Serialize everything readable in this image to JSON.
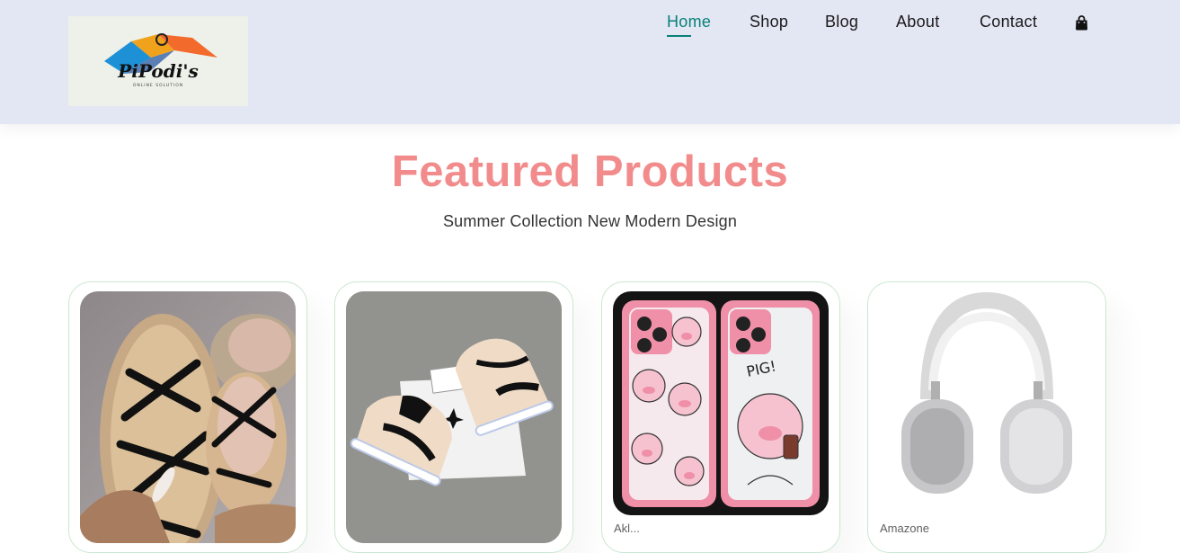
{
  "header": {
    "logo_text": "PiPodi's",
    "logo_tagline": "ONLINE SOLUTION",
    "nav": [
      {
        "label": "Home",
        "active": true
      },
      {
        "label": "Shop",
        "active": false
      },
      {
        "label": "Blog",
        "active": false
      },
      {
        "label": "About",
        "active": false
      },
      {
        "label": "Contact",
        "active": false
      }
    ],
    "cart_icon": "shopping-bag-icon"
  },
  "section": {
    "title": "Featured Products",
    "subtitle": "Summer Collection New Modern Design"
  },
  "products": [
    {
      "image": "strappy-sandals-photo",
      "brand": ""
    },
    {
      "image": "jordan-sneakers-photo",
      "brand": ""
    },
    {
      "image": "pig-phone-cases-photo",
      "brand": "Akl..."
    },
    {
      "image": "silver-over-ear-headphones-photo",
      "brand": "Amazone"
    }
  ],
  "colors": {
    "header_bg": "#e3e6f3",
    "accent": "#088178",
    "title": "#f28c8c",
    "card_border": "#cce7d0"
  }
}
